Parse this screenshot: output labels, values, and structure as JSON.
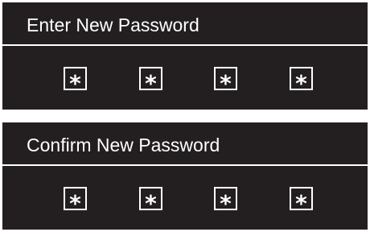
{
  "enter_panel": {
    "title": "Enter New Password",
    "digits": [
      "*",
      "*",
      "*",
      "*"
    ]
  },
  "confirm_panel": {
    "title": "Confirm New Password",
    "digits": [
      "*",
      "*",
      "*",
      "*"
    ]
  },
  "colors": {
    "panel_background": "#231f20",
    "foreground": "#ffffff",
    "page_background": "#ffffff"
  }
}
